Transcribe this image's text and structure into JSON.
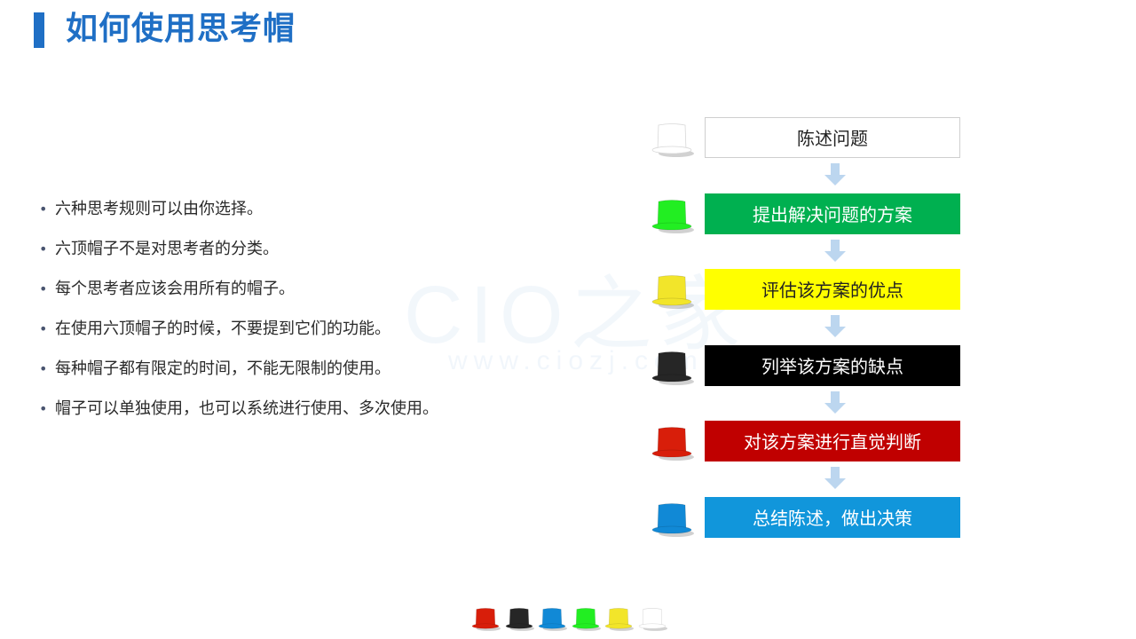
{
  "title": "如何使用思考帽",
  "watermark": {
    "text": "CIO之家",
    "url": "www.ciozj.com"
  },
  "bullets": [
    "六种思考规则可以由你选择。",
    "六顶帽子不是对思考者的分类。",
    "每个思考者应该会用所有的帽子。",
    "在使用六顶帽子的时候，不要提到它们的功能。",
    "每种帽子都有限定的时间，不能无限制的使用。",
    "帽子可以单独使用，也可以系统进行使用、多次使用。"
  ],
  "steps": [
    {
      "label": "陈述问题",
      "hat": "white-hat-icon",
      "color": "#ffffff",
      "text_color": "#222222",
      "hat_color": "#ffffff"
    },
    {
      "label": "提出解决问题的方案",
      "hat": "green-hat-icon",
      "color": "#00b050",
      "text_color": "#ffffff",
      "hat_color": "#22ee22"
    },
    {
      "label": "评估该方案的优点",
      "hat": "yellow-hat-icon",
      "color": "#ffff00",
      "text_color": "#222222",
      "hat_color": "#f2e52a"
    },
    {
      "label": "列举该方案的缺点",
      "hat": "black-hat-icon",
      "color": "#000000",
      "text_color": "#ffffff",
      "hat_color": "#262626"
    },
    {
      "label": "对该方案进行直觉判断",
      "hat": "red-hat-icon",
      "color": "#c00000",
      "text_color": "#ffffff",
      "hat_color": "#d81e0a"
    },
    {
      "label": "总结陈述，做出决策",
      "hat": "blue-hat-icon",
      "color": "#1196db",
      "text_color": "#ffffff",
      "hat_color": "#1189d6"
    }
  ],
  "bottom_hats": [
    {
      "name": "red-hat-icon",
      "color": "#d81e0a"
    },
    {
      "name": "black-hat-icon",
      "color": "#262626"
    },
    {
      "name": "blue-hat-icon",
      "color": "#1189d6"
    },
    {
      "name": "green-hat-icon",
      "color": "#22ee22"
    },
    {
      "name": "yellow-hat-icon",
      "color": "#f2e52a"
    },
    {
      "name": "white-hat-icon",
      "color": "#ffffff"
    }
  ],
  "accent_color": "#1f6fc5",
  "arrow_color": "#bcd6ef"
}
